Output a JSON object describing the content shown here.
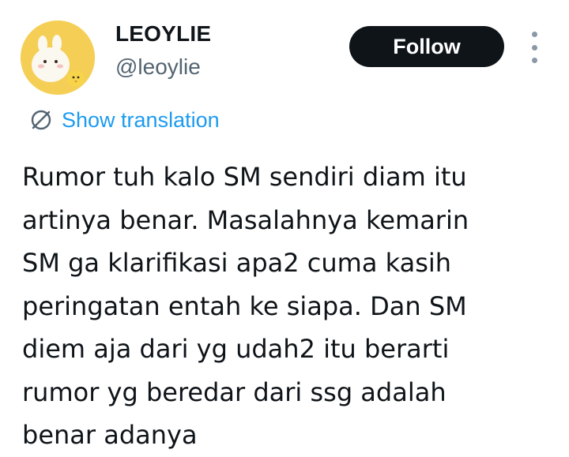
{
  "author": {
    "display_name": "LEOYLIE",
    "handle": "@leoylie",
    "avatar_background": "#f5cf55"
  },
  "follow_button": {
    "label": "Follow"
  },
  "translation": {
    "label": "Show translation",
    "icon": "translate-icon",
    "color": "#1d9bf0"
  },
  "tweet": {
    "lines": [
      "Rumor tuh kalo SM sendiri diam itu",
      "artinya benar. Masalahnya kemarin",
      "SM ga klarifikasi apa2 cuma kasih",
      "peringatan entah ke siapa. Dan SM",
      "diem aja dari yg udah2 itu berarti",
      "rumor yg beredar dari ssg adalah",
      "benar adanya"
    ]
  },
  "colors": {
    "text_primary": "#0f1419",
    "text_secondary": "#536471",
    "button_background": "#0f1419",
    "button_text": "#ffffff"
  }
}
